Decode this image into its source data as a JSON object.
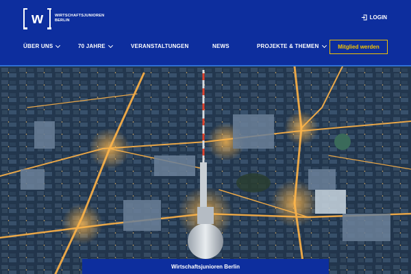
{
  "header": {
    "logo": {
      "mark": "w",
      "line1": "WIRTSCHAFTSJUNIOREN",
      "line2": "BERLIN"
    },
    "login_label": "LOGIN"
  },
  "nav": {
    "items": [
      {
        "label": "ÜBER UNS",
        "has_dropdown": true
      },
      {
        "label": "70 JAHRE",
        "has_dropdown": true
      },
      {
        "label": "VERANSTALTUNGEN",
        "has_dropdown": false
      },
      {
        "label": "NEWS",
        "has_dropdown": false
      },
      {
        "label": "PROJEKTE & THEMEN",
        "has_dropdown": true
      }
    ],
    "cta_label": "Mitglied werden"
  },
  "hero": {
    "image_subject": "night aerial of Berlin with TV tower"
  },
  "banner": {
    "title": "Wirtschaftsjunioren Berlin"
  },
  "colors": {
    "brand_blue": "#0d2e9e",
    "cta_yellow": "#f5c400",
    "accent_line": "#2f6fd6"
  }
}
